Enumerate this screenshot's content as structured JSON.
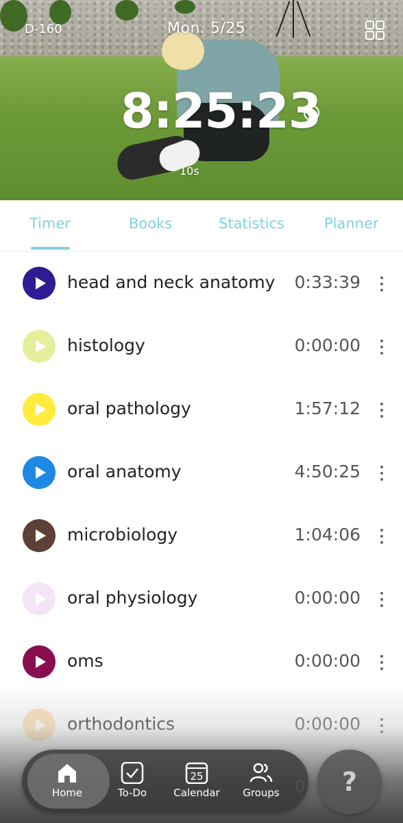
{
  "header": {
    "dday": "D-160",
    "date": "Mon. 5/25",
    "total_time": "8:25:23",
    "interval": "10s",
    "help_symbol": "?",
    "menu_icon": "grid-icon"
  },
  "tabs": [
    {
      "label": "Timer",
      "active": true
    },
    {
      "label": "Books",
      "active": false
    },
    {
      "label": "Statistics",
      "active": false
    },
    {
      "label": "Planner",
      "active": false
    }
  ],
  "subjects": [
    {
      "name": "head and neck anatomy",
      "time": "0:33:39",
      "color": "#311b92"
    },
    {
      "name": "histology",
      "time": "0:00:00",
      "color": "#e6ee9c"
    },
    {
      "name": "oral pathology",
      "time": "1:57:12",
      "color": "#ffeb3b"
    },
    {
      "name": "oral anatomy",
      "time": "4:50:25",
      "color": "#1e88e5"
    },
    {
      "name": "microbiology",
      "time": "1:04:06",
      "color": "#5d4037"
    },
    {
      "name": "oral physiology",
      "time": "0:00:00",
      "color": "#f3e5f5"
    },
    {
      "name": "oms",
      "time": "0:00:00",
      "color": "#880e4f"
    },
    {
      "name": "orthodontics",
      "time": "0:00:00",
      "color": "#ffe0b2"
    }
  ],
  "peek_time_partial": "0",
  "nav": {
    "items": [
      {
        "label": "Home",
        "icon": "home-icon",
        "active": true
      },
      {
        "label": "To-Do",
        "icon": "checkbox-icon",
        "active": false
      },
      {
        "label": "Calendar",
        "icon": "calendar-icon",
        "active": false,
        "badge": "25"
      },
      {
        "label": "Groups",
        "icon": "groups-icon",
        "active": false
      }
    ],
    "help_label": "?"
  },
  "colors": {
    "accent": "#7fd3df",
    "text": "#222222",
    "time_text": "#555555"
  }
}
